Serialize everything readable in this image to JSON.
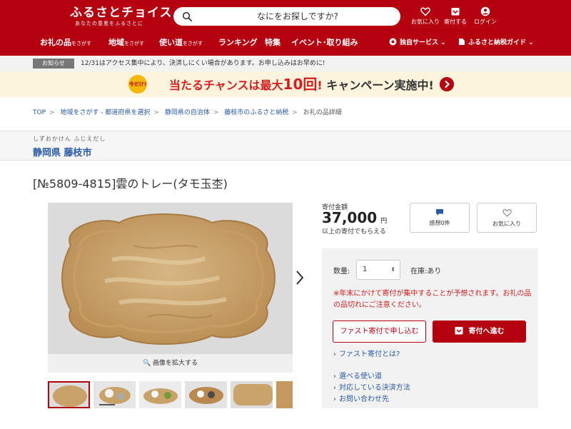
{
  "header": {
    "logo_main": "ふるさとチョイス",
    "logo_sub": "あなたの意思をふるさとに",
    "search_placeholder": "なにをお探しですか?",
    "icons": [
      {
        "label": "お気に入り",
        "icon": "heart-icon"
      },
      {
        "label": "寄付する",
        "icon": "gift-box-icon"
      },
      {
        "label": "ログイン",
        "icon": "user-icon"
      }
    ],
    "nav": [
      {
        "label": "お礼の品",
        "suffix": "をさがす"
      },
      {
        "label": "地域",
        "suffix": "をさがす"
      },
      {
        "label": "使い道",
        "suffix": "をさがす"
      },
      {
        "label": "ランキング",
        "suffix": ""
      },
      {
        "label": "特集",
        "suffix": ""
      },
      {
        "label": "イベント･取り組み",
        "suffix": ""
      }
    ],
    "nav_right": [
      {
        "label": "独自サービス",
        "icon": "services-icon"
      },
      {
        "label": "ふるさと納税ガイド",
        "icon": "guide-icon"
      }
    ]
  },
  "notice": {
    "badge": "お知らせ",
    "text": "12/31はアクセス集中により、決済しにくい場合があります。お申し込みはお早めに!"
  },
  "campaign": {
    "badge": "今だけ!",
    "text_a": "当たるチャンスは最大",
    "text_b": "10回",
    "text_c": "!",
    "text_d": "キャンペーン実施中!",
    "accent_color": "#d61c1c"
  },
  "breadcrumb": [
    "TOP",
    "地域をさがす - 都道府県を選択",
    "静岡県の自治体",
    "藤枝市のふるさと納税",
    "お礼の品詳細"
  ],
  "region": {
    "kana": "しずおかけん ふじえだし",
    "name": "静岡県 藤枝市"
  },
  "product": {
    "title": "[№5809-4815]雲のトレー(タモ玉杢)",
    "zoom_label": "画像を拡大する",
    "thumbnail_count": 6
  },
  "price": {
    "label": "寄付金額",
    "amount": "37,000",
    "unit": "円",
    "note": "以上の寄付でもらえる"
  },
  "actions": {
    "review": "感想0件",
    "favorite": "お気に入り"
  },
  "order": {
    "qty_label": "数量:",
    "qty_value": "1",
    "stock": "在庫:あり",
    "warning": "※年末にかけて寄付が集中することが予想されます。お礼の品の品切れにご注意ください。",
    "fast_btn": "ファスト寄付で申し込む",
    "donate_btn": "寄付へ進む",
    "fast_link": "ファスト寄付とは?",
    "links": [
      "選べる使い道",
      "対応している決済方法",
      "お問い合わせ先"
    ]
  },
  "colors": {
    "brand": "#b5000f",
    "link": "#2a5aa8"
  }
}
